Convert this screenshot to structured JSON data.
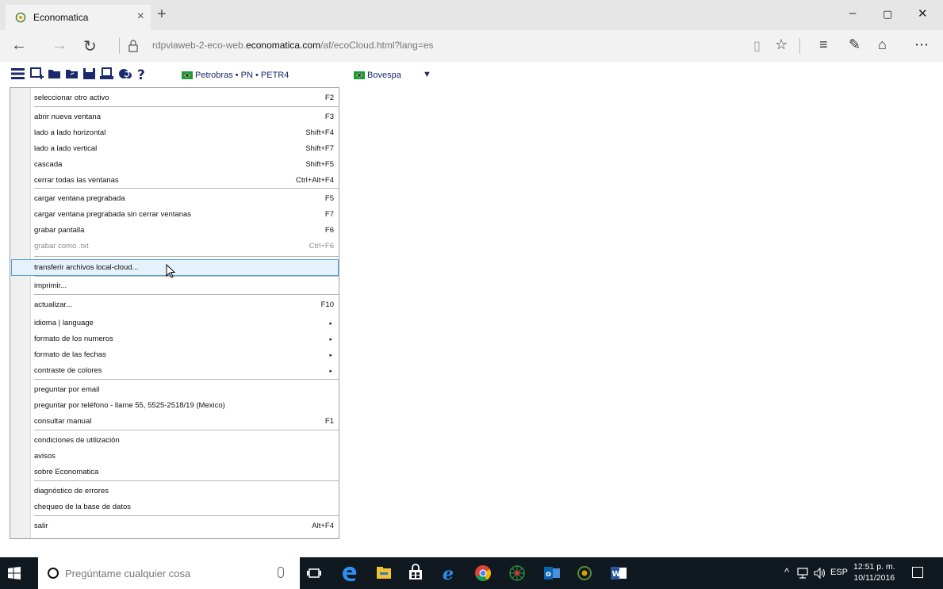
{
  "browser": {
    "tab_title": "Economatica",
    "tab_close": "×",
    "new_tab": "+",
    "window_controls": {
      "minimize": "–",
      "restore": "▢",
      "close": "✕"
    },
    "nav": {
      "back": "←",
      "forward": "→",
      "refresh": "↻"
    },
    "url_prefix": "rdpviaweb-2-eco-web.",
    "url_domain": "economatica.com",
    "url_path": "/af/ecoCloud.html?lang=es",
    "tools": [
      "reading-view-icon",
      "favorite-star-icon",
      "hub-icon",
      "web-note-icon",
      "share-icon",
      "more-icon"
    ],
    "tool_glyphs": {
      "reading": "▯",
      "star": "☆",
      "hub": "≡",
      "note": "✎",
      "share": "⌂",
      "more": "⋯"
    }
  },
  "app_toolbar": {
    "security_label": "Petrobras • PN • PETR4",
    "exchange_label": "Bovespa",
    "dropdown_glyph": "▼"
  },
  "menu": {
    "items": [
      {
        "label": "seleccionar otro activo",
        "shortcut": "F2"
      },
      {
        "label": "abrir nueva ventana",
        "shortcut": "F3"
      },
      {
        "label": "lado a lado horizontal",
        "shortcut": "Shift+F4"
      },
      {
        "label": "lado a lado vertical",
        "shortcut": "Shift+F7"
      },
      {
        "label": "cascada",
        "shortcut": "Shift+F5"
      },
      {
        "label": "cerrar todas las ventanas",
        "shortcut": "Ctrl+Alt+F4"
      },
      {
        "label": "cargar ventana pregrabada",
        "shortcut": "F5"
      },
      {
        "label": "cargar ventana pregrabada sin cerrar ventanas",
        "shortcut": "F7"
      },
      {
        "label": "grabar pantalla",
        "shortcut": "F6"
      },
      {
        "label": "grabar como .txt",
        "shortcut": "Ctrl+F6",
        "disabled": true
      },
      {
        "label": "transferir archivos local-cloud...",
        "shortcut": "",
        "highlighted": true
      },
      {
        "label": "imprimir...",
        "shortcut": ""
      },
      {
        "label": "actualizar...",
        "shortcut": "F10"
      },
      {
        "label": "idioma | language",
        "submenu": true
      },
      {
        "label": "formato de los numeros",
        "submenu": true
      },
      {
        "label": "formato de las fechas",
        "submenu": true
      },
      {
        "label": "contraste de colores",
        "submenu": true
      },
      {
        "label": "preguntar por email",
        "shortcut": ""
      },
      {
        "label": "preguntar por teléfono - llame 55, 5525-2518/19 (Mexico)",
        "shortcut": ""
      },
      {
        "label": "consultar manual",
        "shortcut": "F1"
      },
      {
        "label": "condiciones de utilización",
        "shortcut": ""
      },
      {
        "label": "avisos",
        "shortcut": ""
      },
      {
        "label": "sobre Economatica",
        "shortcut": ""
      },
      {
        "label": "diagnóstico de errores",
        "shortcut": ""
      },
      {
        "label": "chequeo de la base de datos",
        "shortcut": ""
      },
      {
        "label": "salir",
        "shortcut": "Alt+F4"
      }
    ],
    "submenu_glyph": "▸"
  },
  "taskbar": {
    "search_placeholder": "Pregúntame cualquier cosa",
    "language": "ESP",
    "time": "12:51 p. m.",
    "date": "10/11/2016",
    "tray_up": "^"
  },
  "colors": {
    "highlight_bg": "#e5f1fb",
    "highlight_border": "#5b9bd5",
    "app_text": "#1a2a6a",
    "taskbar": "#101820"
  }
}
